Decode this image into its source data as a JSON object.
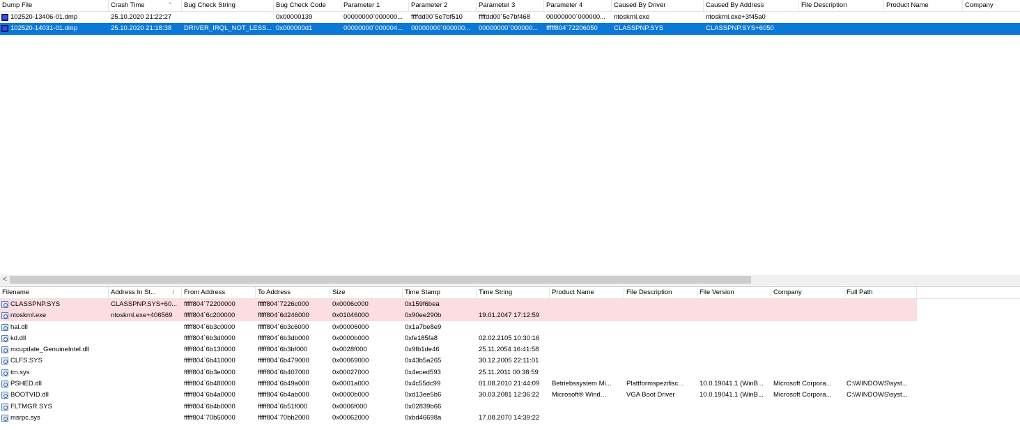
{
  "top_table": {
    "columns": [
      "Dump File",
      "Crash Time",
      "Bug Check String",
      "Bug Check Code",
      "Parameter 1",
      "Parameter 2",
      "Parameter 3",
      "Parameter 4",
      "Caused By Driver",
      "Caused By Address",
      "File Description",
      "Product Name",
      "Company"
    ],
    "sort_indicator": "⌃",
    "rows": [
      [
        "102520-13406-01.dmp",
        "25.10.2020 21:22:27",
        "",
        "0x00000139",
        "00000000`000000...",
        "ffffdd00`5e7bf510",
        "ffffdd00`5e7bf468",
        "00000000`000000...",
        "ntoskrnl.exe",
        "ntoskrnl.exe+3f45a0",
        "",
        "",
        ""
      ],
      [
        "102520-14031-01.dmp",
        "25.10.2020 21:18:38",
        "DRIVER_IRQL_NOT_LESS...",
        "0x000000d1",
        "00000000`000004...",
        "00000000`000000...",
        "00000000`000000...",
        "fffff804`72206050",
        "CLASSPNP.SYS",
        "CLASSPNP.SYS+6050",
        "",
        "",
        ""
      ]
    ],
    "selected_row": 1
  },
  "scrollbar": {
    "left_arrow": "<"
  },
  "bottom_table": {
    "columns": [
      "Filename",
      "Address In St...",
      "From Address",
      "To Address",
      "Size",
      "Time Stamp",
      "Time String",
      "Product Name",
      "File Description",
      "File Version",
      "Company",
      "Full Path"
    ],
    "sort_indicator": "/",
    "rows": [
      [
        "CLASSPNP.SYS",
        "CLASSPNP.SYS+60...",
        "fffff804`72200000",
        "fffff804`7226c000",
        "0x0006c000",
        "0x159f6bea",
        "",
        "",
        "",
        "",
        "",
        ""
      ],
      [
        "ntoskrnl.exe",
        "ntoskrnl.exe+406569",
        "fffff804`6c200000",
        "fffff804`6d246000",
        "0x01046000",
        "0x90ee290b",
        "19.01.2047 17:12:59",
        "",
        "",
        "",
        "",
        ""
      ],
      [
        "hal.dll",
        "",
        "fffff804`6b3c0000",
        "fffff804`6b3c6000",
        "0x00006000",
        "0x1a7be8e9",
        "",
        "",
        "",
        "",
        "",
        ""
      ],
      [
        "kd.dll",
        "",
        "fffff804`6b3d0000",
        "fffff804`6b3db000",
        "0x0000b000",
        "0xfe185fa8",
        "02.02.2105 10:30:16",
        "",
        "",
        "",
        "",
        ""
      ],
      [
        "mcupdate_GenuineIntel.dll",
        "",
        "fffff804`6b130000",
        "fffff804`6b3bf000",
        "0x0028f000",
        "0x9fb1de46",
        "25.11.2054 16:41:58",
        "",
        "",
        "",
        "",
        ""
      ],
      [
        "CLFS.SYS",
        "",
        "fffff804`6b410000",
        "fffff804`6b479000",
        "0x00069000",
        "0x43b5a265",
        "30.12.2005 22:11:01",
        "",
        "",
        "",
        "",
        ""
      ],
      [
        "tm.sys",
        "",
        "fffff804`6b3e0000",
        "fffff804`6b407000",
        "0x00027000",
        "0x4eced593",
        "25.11.2011 00:38:59",
        "",
        "",
        "",
        "",
        ""
      ],
      [
        "PSHED.dll",
        "",
        "fffff804`6b480000",
        "fffff804`6b49a000",
        "0x0001a000",
        "0x4c55dc99",
        "01.08.2010 21:44:09",
        "Betriebssystem Mi...",
        "Plattformspezifisc...",
        "10.0.19041.1 (WinB...",
        "Microsoft Corpora...",
        "C:\\WINDOWS\\syst..."
      ],
      [
        "BOOTVID.dll",
        "",
        "fffff804`6b4a0000",
        "fffff804`6b4ab000",
        "0x0000b000",
        "0xd13ee5b6",
        "30.03.2081 12:36:22",
        "Microsoft® Wind...",
        "VGA Boot Driver",
        "10.0.19041.1 (WinB...",
        "Microsoft Corpora...",
        "C:\\WINDOWS\\syst..."
      ],
      [
        "FLTMGR.SYS",
        "",
        "fffff804`6b4b0000",
        "fffff804`6b51f000",
        "0x0006f000",
        "0x02839b66",
        "",
        "",
        "",
        "",
        "",
        ""
      ],
      [
        "msrpc.sys",
        "",
        "fffff804`70b50000",
        "fffff804`70bb2000",
        "0x00062000",
        "0xbd46698a",
        "17.08.2070 14:39:22",
        "",
        "",
        "",
        "",
        ""
      ]
    ],
    "highlighted_rows": [
      0,
      1
    ]
  },
  "colors": {
    "selection": "#0a78d7",
    "highlight": "#fcdde1"
  }
}
